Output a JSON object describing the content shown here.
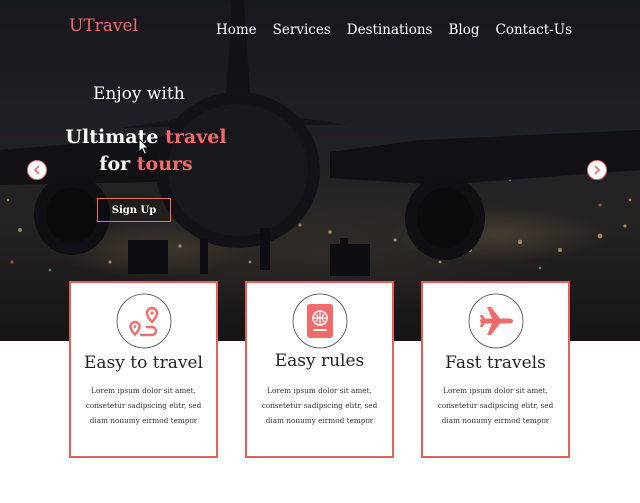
{
  "header": {
    "logo_initial": "U",
    "logo_rest": "Travel",
    "nav": [
      "Home",
      "Services",
      "Destinations",
      "Blog",
      "Contact-Us"
    ]
  },
  "hero": {
    "subtitle": "Enjoy with",
    "title_part1": "Ultimate ",
    "title_accent1": "travel",
    "title_part2": "for ",
    "title_accent2": "tours",
    "signup_label": "Sign Up",
    "prev_icon": "chevron-left-icon",
    "next_icon": "chevron-right-icon"
  },
  "features": [
    {
      "icon": "route-icon",
      "title": "Easy to travel",
      "body": [
        "Lorem ipsum dolor sit amet,",
        "consetetur sadipscing elitr, sed",
        "diam nonumy eirmod tempor"
      ]
    },
    {
      "icon": "passport-icon",
      "title": "Easy rules",
      "body": [
        "Lorem ipsum dolor sit amet,",
        "consetetur sadipscing elitr, sed",
        "diam nonumy eirmod tempor"
      ]
    },
    {
      "icon": "airplane-icon",
      "title": "Fast travels",
      "body": [
        "Lorem ipsum dolor sit amet,",
        "consetetur sadipscing elitr, sed",
        "diam nonumy eirmod tempor"
      ]
    }
  ],
  "colors": {
    "accent": "#f26b6b",
    "card_border": "#e55f5f"
  }
}
